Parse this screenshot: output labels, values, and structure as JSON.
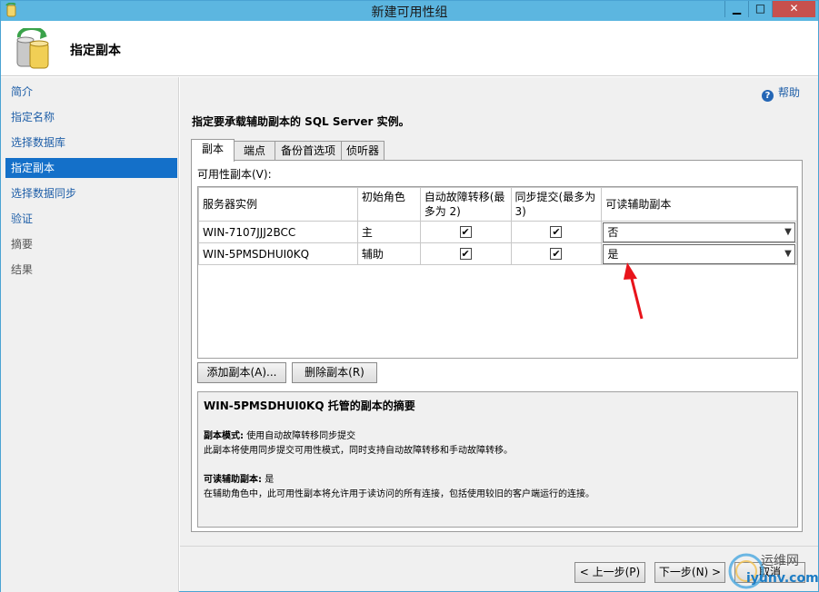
{
  "window": {
    "title": "新建可用性组",
    "min": "▁",
    "max": "□",
    "close": "✕"
  },
  "header": {
    "title": "指定副本"
  },
  "sidebar": {
    "items": [
      {
        "label": "简介",
        "state": "link"
      },
      {
        "label": "指定名称",
        "state": "link"
      },
      {
        "label": "选择数据库",
        "state": "link"
      },
      {
        "label": "指定副本",
        "state": "active"
      },
      {
        "label": "选择数据同步",
        "state": "link"
      },
      {
        "label": "验证",
        "state": "link"
      },
      {
        "label": "摘要",
        "state": "disabled"
      },
      {
        "label": "结果",
        "state": "disabled"
      }
    ]
  },
  "main": {
    "help": "帮助",
    "instruction": "指定要承载辅助副本的 SQL Server 实例。",
    "tabs": [
      "副本",
      "端点",
      "备份首选项",
      "侦听器"
    ],
    "grid_label": "可用性副本(V):",
    "columns": [
      "服务器实例",
      "初始角色",
      "自动故障转移(最多为 2)",
      "同步提交(最多为 3)",
      "可读辅助副本"
    ],
    "rows": [
      {
        "server": "WIN-7107JJJ2BCC",
        "role": "主",
        "auto_failover": true,
        "sync_commit": true,
        "readable": "否"
      },
      {
        "server": "WIN-5PMSDHUI0KQ",
        "role": "辅助",
        "auto_failover": true,
        "sync_commit": true,
        "readable": "是"
      }
    ],
    "add_button": "添加副本(A)...",
    "remove_button": "删除副本(R)",
    "summary": {
      "title": "WIN-5PMSDHUI0KQ 托管的副本的摘要",
      "mode_label": "副本模式:",
      "mode_value": "使用自动故障转移同步提交",
      "mode_desc": "此副本将使用同步提交可用性模式，同时支持自动故障转移和手动故障转移。",
      "readable_label": "可读辅助副本:",
      "readable_value": "是",
      "readable_desc": "在辅助角色中，此可用性副本将允许用于读访问的所有连接，包括使用较旧的客户端运行的连接。"
    }
  },
  "footer": {
    "prev": "< 上一步(P)",
    "next": "下一步(N) >",
    "cancel": "取消"
  },
  "watermark": {
    "line1": "运维网",
    "line2": "iyunv.com"
  },
  "colors": {
    "accent": "#1470c9",
    "titlebar": "#5cb6e0",
    "close": "#c7504d",
    "annotation": "#e8141b"
  }
}
